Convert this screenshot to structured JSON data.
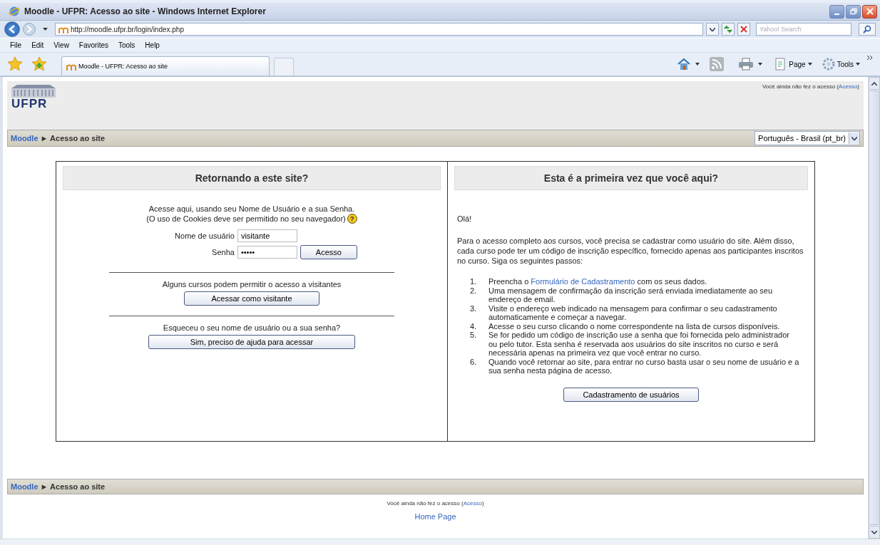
{
  "window": {
    "title": "Moodle - UFPR: Acesso ao site - Windows Internet Explorer"
  },
  "address_bar": {
    "url": "http://moodle.ufpr.br/login/index.php",
    "search_placeholder": "Yahoo! Search"
  },
  "menu": [
    "File",
    "Edit",
    "View",
    "Favorites",
    "Tools",
    "Help"
  ],
  "tab": {
    "title": "Moodle - UFPR: Acesso ao site"
  },
  "command_bar": {
    "page": "Page",
    "tools": "Tools"
  },
  "header": {
    "logo": "UFPR",
    "login_info": "Você ainda não fez o acesso (",
    "login_link": "Acesso",
    "login_close": ")"
  },
  "breadcrumb": {
    "home": "Moodle",
    "separator": "►",
    "current": "Acesso ao site"
  },
  "language": {
    "value": "Português - Brasil (pt_br)"
  },
  "returning": {
    "title": "Retornando a este site?",
    "intro_1": "Acesse aqui, usando seu Nome de Usuário e a sua Senha.",
    "intro_2": "(O uso de Cookies deve ser permitido no seu navegador)",
    "help": "?",
    "username_label": "Nome de usuário",
    "username": "visitante",
    "password_label": "Senha",
    "password": "•••••",
    "login_button": "Acesso",
    "guest_text": "Alguns cursos podem permitir o acesso a visitantes",
    "guest_button": "Acessar como visitante",
    "forgot_text": "Esqueceu o seu nome de usuário ou a sua senha?",
    "forgot_button": "Sim, preciso de ajuda para acessar"
  },
  "first_time": {
    "title": "Esta é a primeira vez que você aqui?",
    "greeting": "Olá!",
    "intro": "Para o acesso completo aos cursos, você precisa se cadastrar como usuário do site. Além disso, cada curso pode ter um código de inscrição específico, fornecido apenas aos participantes inscritos no curso. Siga os seguintes passos:",
    "steps": [
      {
        "number": "1.",
        "before": "Preencha o ",
        "link": "Formulário de Cadastramento",
        "after": " com os seus dados."
      },
      {
        "number": "2.",
        "before": "Uma mensagem de confirmação da inscrição será enviada imediatamente ao seu endereço de email."
      },
      {
        "number": "3.",
        "before": "Visite o endereço web indicado na mensagem para confirmar o seu cadastramento automaticamente e começar a navegar."
      },
      {
        "number": "4.",
        "before": "Acesse o seu curso clicando o nome correspondente na lista de cursos disponíveis."
      },
      {
        "number": "5.",
        "before": "Se for pedido um código de inscrição use a senha que foi fornecida pelo administrador ou pelo tutor. Esta senha é reservada aos usuários do site inscritos no curso e será necessária apenas na primeira vez que você entrar no curso."
      },
      {
        "number": "6.",
        "before": "Quando você retornar ao site, para entrar no curso basta usar o seu nome de usuário e a sua senha nesta página de acesso."
      }
    ],
    "signup_button": "Cadastramento de usuários"
  },
  "footer": {
    "breadcrumb": {
      "home": "Moodle",
      "separator": "►",
      "current": "Acesso ao site"
    },
    "login_info": "Você ainda não fez o acesso (",
    "login_link": "Acesso",
    "login_close": ")",
    "home_link": "Home Page"
  }
}
